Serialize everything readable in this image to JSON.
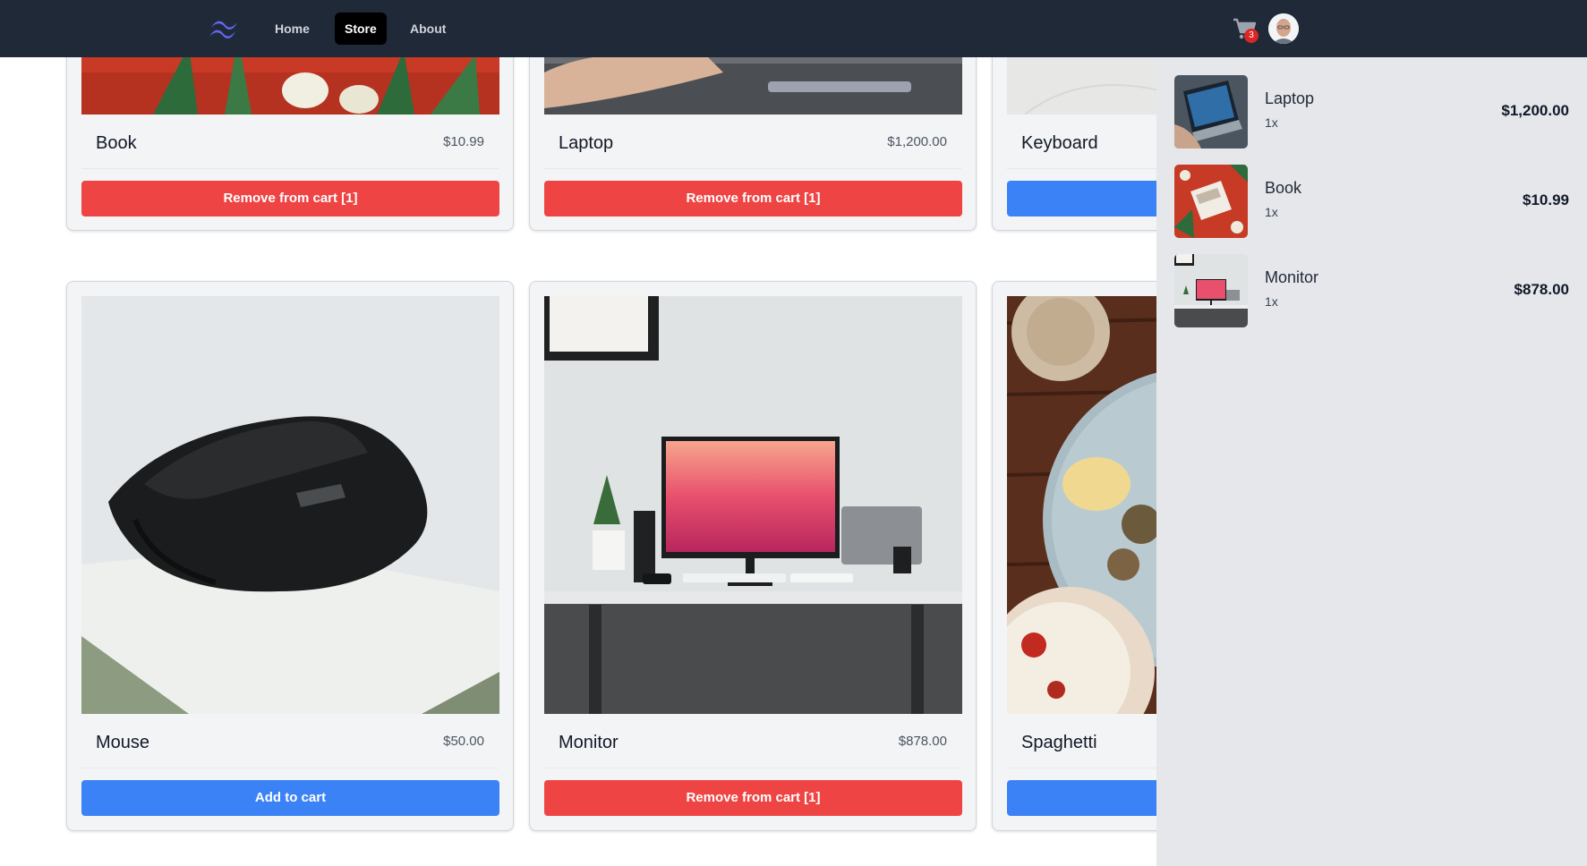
{
  "nav": {
    "links": [
      "Home",
      "Store",
      "About"
    ],
    "cart_count": "3"
  },
  "products": [
    {
      "name": "Book",
      "price": "$10.99",
      "button": "Remove from cart [1]",
      "in_cart": true
    },
    {
      "name": "Laptop",
      "price": "$1,200.00",
      "button": "Remove from cart [1]",
      "in_cart": true
    },
    {
      "name": "Keyboard",
      "price": "",
      "button": "",
      "in_cart": false
    },
    {
      "name": "Mouse",
      "price": "$50.00",
      "button": "Add to cart",
      "in_cart": false
    },
    {
      "name": "Monitor",
      "price": "$878.00",
      "button": "Remove from cart [1]",
      "in_cart": true
    },
    {
      "name": "Spaghetti",
      "price": "",
      "button": "",
      "in_cart": false
    }
  ],
  "cart": {
    "items": [
      {
        "name": "Laptop",
        "qty": "1x",
        "total": "$1,200.00"
      },
      {
        "name": "Book",
        "qty": "1x",
        "total": "$10.99"
      },
      {
        "name": "Monitor",
        "qty": "1x",
        "total": "$878.00"
      }
    ]
  },
  "colors": {
    "navbar": "#1f2937",
    "remove_button": "#ef4444",
    "add_button": "#3b82f6",
    "cart_panel": "#e5e7eb",
    "badge": "#dc2626"
  }
}
